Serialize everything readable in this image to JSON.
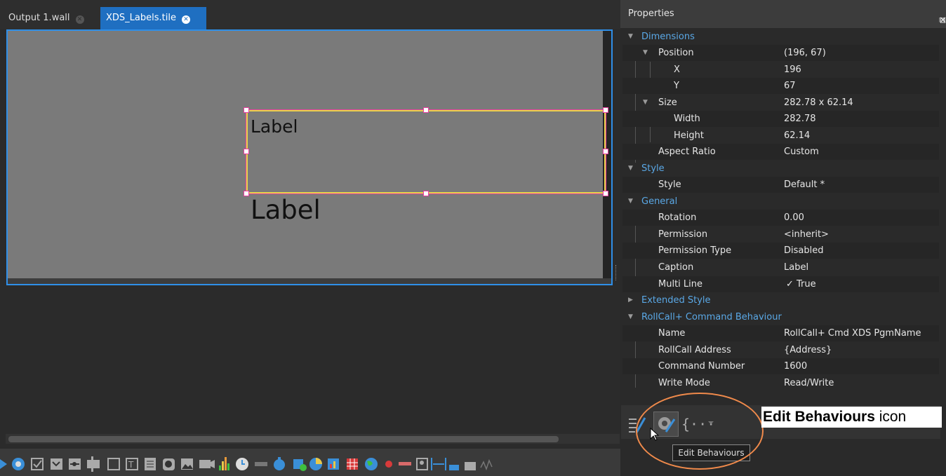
{
  "tabs": {
    "tab1": "Output 1.wall",
    "tab2": "XDS_Labels.tile"
  },
  "canvas": {
    "label1": "Label",
    "label2": "Label"
  },
  "properties": {
    "title": "Properties",
    "rows": {
      "dimensions": "Dimensions",
      "position": {
        "name": "Position",
        "value": "(196, 67)"
      },
      "x": {
        "name": "X",
        "value": "196"
      },
      "y": {
        "name": "Y",
        "value": "67"
      },
      "size": {
        "name": "Size",
        "value": "282.78 x 62.14"
      },
      "width": {
        "name": "Width",
        "value": "282.78"
      },
      "height": {
        "name": "Height",
        "value": "62.14"
      },
      "aspect": {
        "name": "Aspect Ratio",
        "value": "Custom"
      },
      "style_cat": "Style",
      "style": {
        "name": "Style",
        "value": "Default *"
      },
      "general": "General",
      "rotation": {
        "name": "Rotation",
        "value": "0.00"
      },
      "permission": {
        "name": "Permission",
        "value": "<inherit>"
      },
      "permission_type": {
        "name": "Permission Type",
        "value": "Disabled"
      },
      "caption": {
        "name": "Caption",
        "value": "Label"
      },
      "multiline": {
        "name": "Multi Line",
        "value": "✓  True"
      },
      "extended": "Extended Style",
      "rollcall_cat": "RollCall+ Command Behaviour",
      "rc_name": {
        "name": "Name",
        "value": "RollCall+ Cmd XDS PgmName"
      },
      "rc_address": {
        "name": "RollCall Address",
        "value": "{Address}"
      },
      "rc_command": {
        "name": "Command Number",
        "value": "1600"
      },
      "rc_write": {
        "name": "Write Mode",
        "value": "Read/Write"
      }
    }
  },
  "tooltip": "Edit Behaviours",
  "callout": {
    "bold": "Edit Behaviours",
    "rest": " icon"
  },
  "colors": {
    "accent": "#1f6fc1",
    "selection": "#e83fa0",
    "callout_ring": "#f08a4b"
  }
}
